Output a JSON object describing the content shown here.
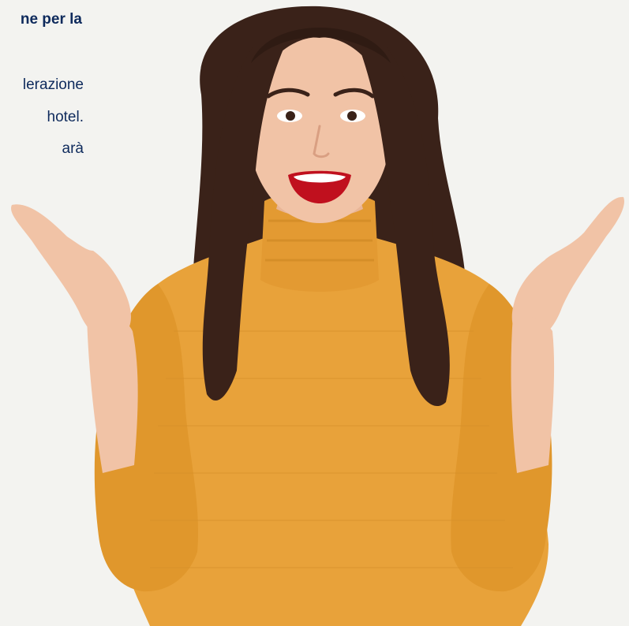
{
  "text_panel": {
    "heading": "ne per la",
    "lines": [
      "lerazione",
      "hotel.",
      "arà"
    ]
  },
  "photo": {
    "subject": "woman-in-mustard-turtleneck",
    "colors": {
      "background": "#f3f3f0",
      "sweater": "#e8a23a",
      "hair": "#3a2219",
      "skin": "#f1c3a6",
      "lips": "#c0101e",
      "text": "#0e2a5c"
    }
  }
}
